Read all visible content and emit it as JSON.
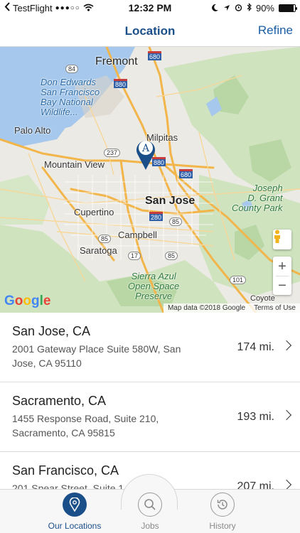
{
  "status_bar": {
    "carrier": "TestFlight",
    "time": "12:32 PM",
    "battery": "90%",
    "battery_level": 0.9,
    "icons": [
      "back-arrow-icon",
      "signal-dots-icon",
      "wifi-icon",
      "moon-icon",
      "location-arrow-icon",
      "alarm-icon",
      "bluetooth-icon",
      "battery-icon"
    ]
  },
  "nav": {
    "title": "Location",
    "refine_label": "Refine"
  },
  "map": {
    "marker_label": "A",
    "cities": [
      "Fremont",
      "Milpitas",
      "Palo Alto",
      "Mountain View",
      "San Jose",
      "Cupertino",
      "Campbell",
      "Saratoga",
      "Coyote"
    ],
    "parks": {
      "don_edwards": [
        "Don Edwards",
        "San Francisco",
        "Bay National",
        "Wildlife..."
      ],
      "grant": [
        "Joseph",
        "D. Grant",
        "County Park"
      ],
      "sierra": [
        "Sierra Azul",
        "Open Space",
        "Preserve"
      ]
    },
    "highways": [
      "680",
      "84",
      "880",
      "237",
      "880",
      "680",
      "280",
      "85",
      "85",
      "17",
      "85",
      "101"
    ],
    "google": "Google",
    "attribution": "Map data ©2018 Google",
    "terms": "Terms of Use",
    "zoom_in": "+",
    "zoom_out": "−"
  },
  "locations": [
    {
      "name": "San Jose, CA",
      "address": "2001 Gateway Place Suite 580W, San Jose, CA 95110",
      "distance": "174 mi."
    },
    {
      "name": "Sacramento, CA",
      "address": "1455 Response Road, Suite 210, Sacramento, CA 95815",
      "distance": "193 mi."
    },
    {
      "name": "San Francisco, CA",
      "address": "201 Spear Street, Suite 1",
      "distance": "207 mi."
    }
  ],
  "tabs": [
    {
      "label": "Our Locations",
      "icon": "location-pin-icon",
      "active": true
    },
    {
      "label": "Jobs",
      "icon": "search-icon",
      "active": false
    },
    {
      "label": "History",
      "icon": "history-icon",
      "active": false
    }
  ],
  "colors": {
    "brand": "#1b4f8a",
    "link": "#1b5ea4"
  }
}
